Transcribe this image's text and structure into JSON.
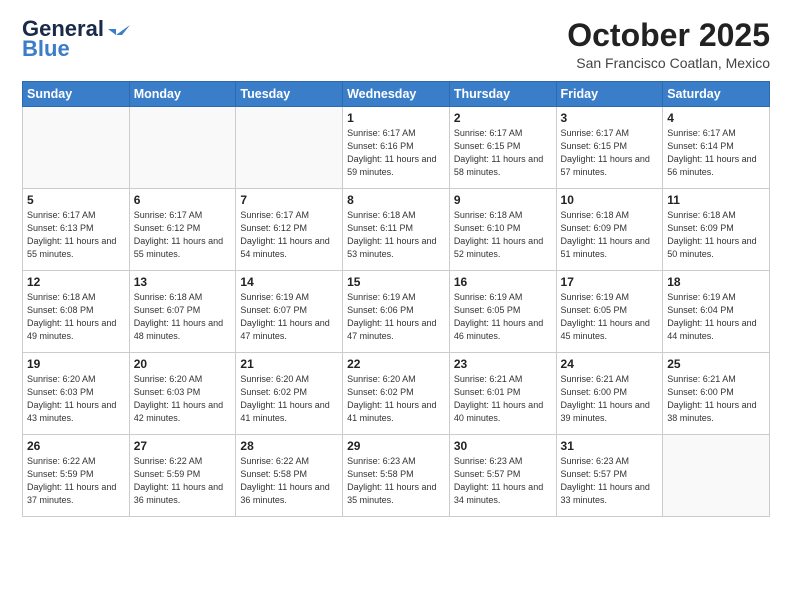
{
  "header": {
    "logo_general": "General",
    "logo_blue": "Blue",
    "month": "October 2025",
    "location": "San Francisco Coatlan, Mexico"
  },
  "days_of_week": [
    "Sunday",
    "Monday",
    "Tuesday",
    "Wednesday",
    "Thursday",
    "Friday",
    "Saturday"
  ],
  "weeks": [
    [
      {
        "day": "",
        "info": ""
      },
      {
        "day": "",
        "info": ""
      },
      {
        "day": "",
        "info": ""
      },
      {
        "day": "1",
        "info": "Sunrise: 6:17 AM\nSunset: 6:16 PM\nDaylight: 11 hours\nand 59 minutes."
      },
      {
        "day": "2",
        "info": "Sunrise: 6:17 AM\nSunset: 6:15 PM\nDaylight: 11 hours\nand 58 minutes."
      },
      {
        "day": "3",
        "info": "Sunrise: 6:17 AM\nSunset: 6:15 PM\nDaylight: 11 hours\nand 57 minutes."
      },
      {
        "day": "4",
        "info": "Sunrise: 6:17 AM\nSunset: 6:14 PM\nDaylight: 11 hours\nand 56 minutes."
      }
    ],
    [
      {
        "day": "5",
        "info": "Sunrise: 6:17 AM\nSunset: 6:13 PM\nDaylight: 11 hours\nand 55 minutes."
      },
      {
        "day": "6",
        "info": "Sunrise: 6:17 AM\nSunset: 6:12 PM\nDaylight: 11 hours\nand 55 minutes."
      },
      {
        "day": "7",
        "info": "Sunrise: 6:17 AM\nSunset: 6:12 PM\nDaylight: 11 hours\nand 54 minutes."
      },
      {
        "day": "8",
        "info": "Sunrise: 6:18 AM\nSunset: 6:11 PM\nDaylight: 11 hours\nand 53 minutes."
      },
      {
        "day": "9",
        "info": "Sunrise: 6:18 AM\nSunset: 6:10 PM\nDaylight: 11 hours\nand 52 minutes."
      },
      {
        "day": "10",
        "info": "Sunrise: 6:18 AM\nSunset: 6:09 PM\nDaylight: 11 hours\nand 51 minutes."
      },
      {
        "day": "11",
        "info": "Sunrise: 6:18 AM\nSunset: 6:09 PM\nDaylight: 11 hours\nand 50 minutes."
      }
    ],
    [
      {
        "day": "12",
        "info": "Sunrise: 6:18 AM\nSunset: 6:08 PM\nDaylight: 11 hours\nand 49 minutes."
      },
      {
        "day": "13",
        "info": "Sunrise: 6:18 AM\nSunset: 6:07 PM\nDaylight: 11 hours\nand 48 minutes."
      },
      {
        "day": "14",
        "info": "Sunrise: 6:19 AM\nSunset: 6:07 PM\nDaylight: 11 hours\nand 47 minutes."
      },
      {
        "day": "15",
        "info": "Sunrise: 6:19 AM\nSunset: 6:06 PM\nDaylight: 11 hours\nand 47 minutes."
      },
      {
        "day": "16",
        "info": "Sunrise: 6:19 AM\nSunset: 6:05 PM\nDaylight: 11 hours\nand 46 minutes."
      },
      {
        "day": "17",
        "info": "Sunrise: 6:19 AM\nSunset: 6:05 PM\nDaylight: 11 hours\nand 45 minutes."
      },
      {
        "day": "18",
        "info": "Sunrise: 6:19 AM\nSunset: 6:04 PM\nDaylight: 11 hours\nand 44 minutes."
      }
    ],
    [
      {
        "day": "19",
        "info": "Sunrise: 6:20 AM\nSunset: 6:03 PM\nDaylight: 11 hours\nand 43 minutes."
      },
      {
        "day": "20",
        "info": "Sunrise: 6:20 AM\nSunset: 6:03 PM\nDaylight: 11 hours\nand 42 minutes."
      },
      {
        "day": "21",
        "info": "Sunrise: 6:20 AM\nSunset: 6:02 PM\nDaylight: 11 hours\nand 41 minutes."
      },
      {
        "day": "22",
        "info": "Sunrise: 6:20 AM\nSunset: 6:02 PM\nDaylight: 11 hours\nand 41 minutes."
      },
      {
        "day": "23",
        "info": "Sunrise: 6:21 AM\nSunset: 6:01 PM\nDaylight: 11 hours\nand 40 minutes."
      },
      {
        "day": "24",
        "info": "Sunrise: 6:21 AM\nSunset: 6:00 PM\nDaylight: 11 hours\nand 39 minutes."
      },
      {
        "day": "25",
        "info": "Sunrise: 6:21 AM\nSunset: 6:00 PM\nDaylight: 11 hours\nand 38 minutes."
      }
    ],
    [
      {
        "day": "26",
        "info": "Sunrise: 6:22 AM\nSunset: 5:59 PM\nDaylight: 11 hours\nand 37 minutes."
      },
      {
        "day": "27",
        "info": "Sunrise: 6:22 AM\nSunset: 5:59 PM\nDaylight: 11 hours\nand 36 minutes."
      },
      {
        "day": "28",
        "info": "Sunrise: 6:22 AM\nSunset: 5:58 PM\nDaylight: 11 hours\nand 36 minutes."
      },
      {
        "day": "29",
        "info": "Sunrise: 6:23 AM\nSunset: 5:58 PM\nDaylight: 11 hours\nand 35 minutes."
      },
      {
        "day": "30",
        "info": "Sunrise: 6:23 AM\nSunset: 5:57 PM\nDaylight: 11 hours\nand 34 minutes."
      },
      {
        "day": "31",
        "info": "Sunrise: 6:23 AM\nSunset: 5:57 PM\nDaylight: 11 hours\nand 33 minutes."
      },
      {
        "day": "",
        "info": ""
      }
    ]
  ]
}
